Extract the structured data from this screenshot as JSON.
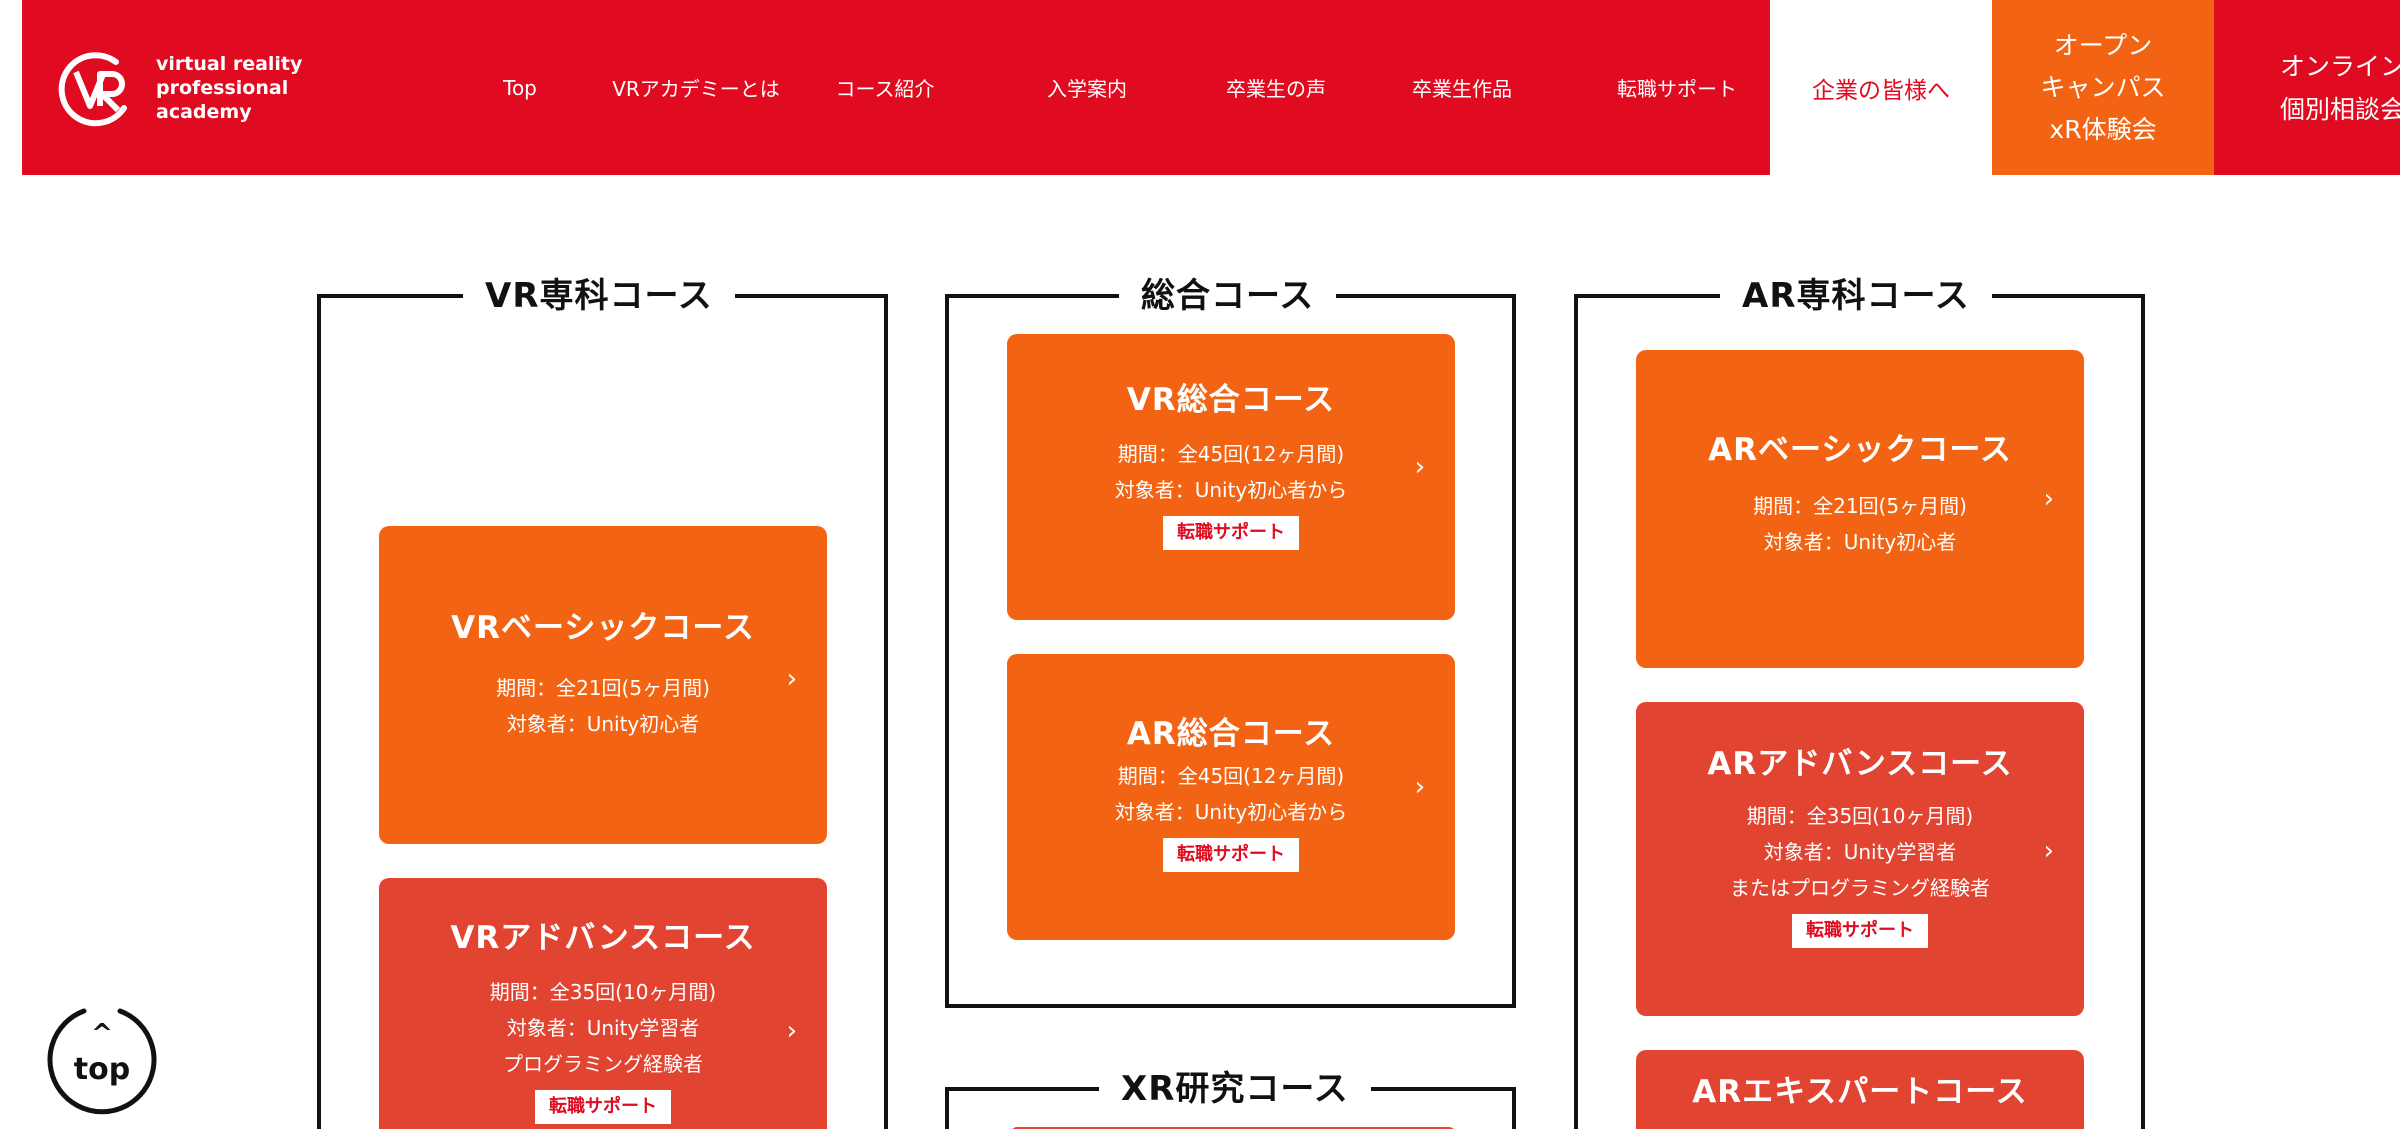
{
  "header": {
    "logo": [
      "virtual reality",
      "professional",
      "academy"
    ],
    "nav": [
      {
        "label": "Top"
      },
      {
        "label": "VRアカデミーとは"
      },
      {
        "label": "コース紹介"
      },
      {
        "label": "入学案内"
      },
      {
        "label": "卒業生の声"
      },
      {
        "label": "卒業生作品"
      },
      {
        "label": "転職サポート"
      }
    ],
    "corporate": "企業の皆様へ",
    "open_campus": [
      "オープン",
      "キャンパス",
      "xR体験会"
    ],
    "online": [
      "オンライン",
      "個別相談会"
    ]
  },
  "sections": {
    "vr": {
      "title": "VR専科コース",
      "cards": [
        {
          "title": "VRベーシックコース",
          "lines": [
            "期間：全21回(5ヶ月間)",
            "対象者：Unity初心者"
          ]
        },
        {
          "title": "VRアドバンスコース",
          "lines": [
            "期間：全35回(10ヶ月間)",
            "対象者：Unity学習者",
            "プログラミング経験者"
          ],
          "badge": "転職サポート"
        }
      ]
    },
    "general": {
      "title": "総合コース",
      "cards": [
        {
          "title": "VR総合コース",
          "lines": [
            "期間：全45回(12ヶ月間)",
            "対象者：Unity初心者から"
          ],
          "badge": "転職サポート"
        },
        {
          "title": "AR総合コース",
          "lines": [
            "期間：全45回(12ヶ月間)",
            "対象者：Unity初心者から"
          ],
          "badge": "転職サポート"
        }
      ]
    },
    "xr": {
      "title": "XR研究コース"
    },
    "ar": {
      "title": "AR専科コース",
      "cards": [
        {
          "title": "ARベーシックコース",
          "lines": [
            "期間：全21回(5ヶ月間)",
            "対象者：Unity初心者"
          ]
        },
        {
          "title": "ARアドバンスコース",
          "lines": [
            "期間：全35回(10ヶ月間)",
            "対象者：Unity学習者",
            "またはプログラミング経験者"
          ],
          "badge": "転職サポート"
        },
        {
          "title": "ARエキスパートコース"
        }
      ]
    }
  },
  "top_button": {
    "label": "top",
    "caret": "^"
  },
  "icons": {
    "arrow": "chevron-right-icon",
    "logo": "vr-logo-icon"
  },
  "colors": {
    "brand_red": "#e00b20",
    "orange": "#f26413",
    "card_red": "#e24432"
  }
}
